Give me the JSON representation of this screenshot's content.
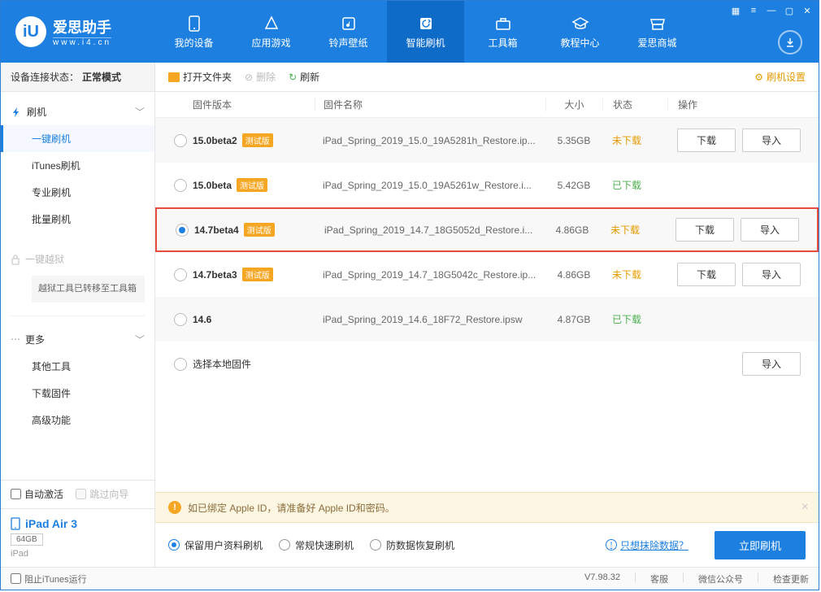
{
  "logo": {
    "cn": "爱思助手",
    "url": "www.i4.cn",
    "glyph": "iU"
  },
  "nav": [
    {
      "label": "我的设备"
    },
    {
      "label": "应用游戏"
    },
    {
      "label": "铃声壁纸"
    },
    {
      "label": "智能刷机"
    },
    {
      "label": "工具箱"
    },
    {
      "label": "教程中心"
    },
    {
      "label": "爱思商城"
    }
  ],
  "sidebar": {
    "status_label": "设备连接状态：",
    "status_value": "正常模式",
    "flash_head": "刷机",
    "flash_items": {
      "oneclick": "一键刷机",
      "itunes": "iTunes刷机",
      "pro": "专业刷机",
      "batch": "批量刷机"
    },
    "jailbreak": "一键越狱",
    "jb_note": "越狱工具已转移至工具箱",
    "more_head": "更多",
    "more_items": {
      "other": "其他工具",
      "download": "下载固件",
      "advanced": "高级功能"
    },
    "auto_activate": "自动激活",
    "skip_guide": "跳过向导",
    "device_name": "iPad Air 3",
    "device_cap": "64GB",
    "device_type": "iPad"
  },
  "toolbar": {
    "open": "打开文件夹",
    "delete": "删除",
    "refresh": "刷新",
    "settings": "刷机设置"
  },
  "table": {
    "head": {
      "ver": "固件版本",
      "name": "固件名称",
      "size": "大小",
      "status": "状态",
      "ops": "操作"
    },
    "beta_tag": "测试版",
    "btn_download": "下载",
    "btn_import": "导入",
    "local_label": "选择本地固件",
    "rows": [
      {
        "ver": "15.0beta2",
        "beta": true,
        "name": "iPad_Spring_2019_15.0_19A5281h_Restore.ip...",
        "size": "5.35GB",
        "status": "未下载",
        "st_class": "st-not",
        "download": true,
        "import": true,
        "selected": false
      },
      {
        "ver": "15.0beta",
        "beta": true,
        "name": "iPad_Spring_2019_15.0_19A5261w_Restore.i...",
        "size": "5.42GB",
        "status": "已下载",
        "st_class": "st-done",
        "download": false,
        "import": false,
        "selected": false
      },
      {
        "ver": "14.7beta4",
        "beta": true,
        "name": "iPad_Spring_2019_14.7_18G5052d_Restore.i...",
        "size": "4.86GB",
        "status": "未下载",
        "st_class": "st-not",
        "download": true,
        "import": true,
        "selected": true,
        "highlight": true
      },
      {
        "ver": "14.7beta3",
        "beta": true,
        "name": "iPad_Spring_2019_14.7_18G5042c_Restore.ip...",
        "size": "4.86GB",
        "status": "未下载",
        "st_class": "st-not",
        "download": true,
        "import": true,
        "selected": false
      },
      {
        "ver": "14.6",
        "beta": false,
        "name": "iPad_Spring_2019_14.6_18F72_Restore.ipsw",
        "size": "4.87GB",
        "status": "已下载",
        "st_class": "st-done",
        "download": false,
        "import": false,
        "selected": false
      }
    ]
  },
  "warning": "如已绑定 Apple ID，请准备好 Apple ID和密码。",
  "options": {
    "keep_data": "保留用户资料刷机",
    "normal": "常规快速刷机",
    "anti_loss": "防数据恢复刷机",
    "erase_link": "只想抹除数据？",
    "flash_now": "立即刷机"
  },
  "footer": {
    "block_itunes": "阻止iTunes运行",
    "version": "V7.98.32",
    "service": "客服",
    "wechat": "微信公众号",
    "update": "检查更新"
  }
}
